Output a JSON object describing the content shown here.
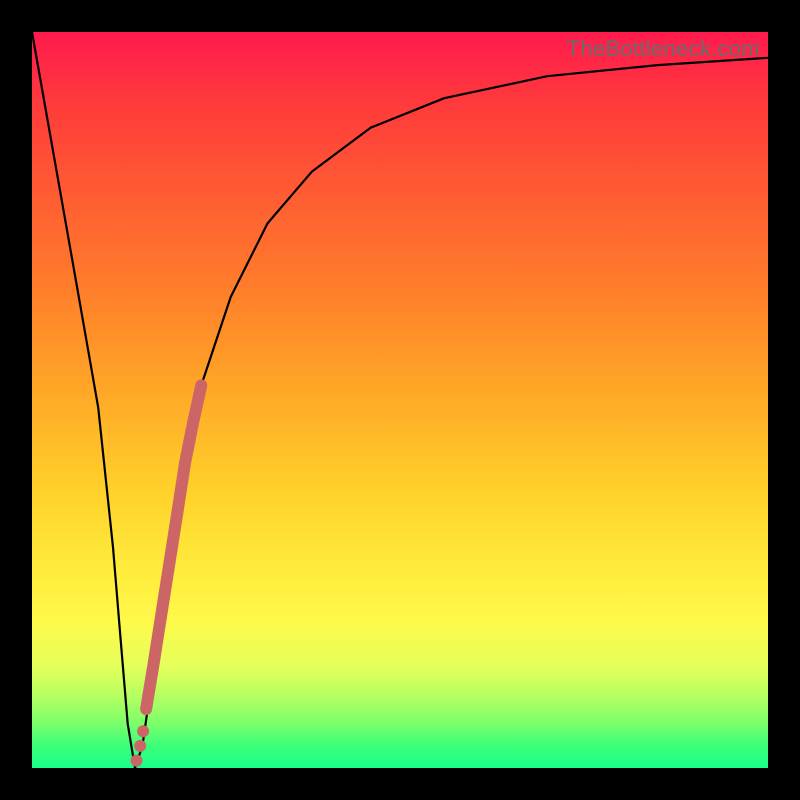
{
  "watermark": "TheBottleneck.com",
  "chart_data": {
    "type": "line",
    "title": "",
    "xlabel": "",
    "ylabel": "",
    "xlim": [
      0,
      100
    ],
    "ylim": [
      0,
      100
    ],
    "series": [
      {
        "name": "bottleneck-curve",
        "x": [
          0,
          3,
          6,
          9,
          11,
          12,
          13,
          14,
          15,
          16,
          18,
          20,
          23,
          27,
          32,
          38,
          46,
          56,
          70,
          85,
          100
        ],
        "y": [
          100,
          83,
          66,
          49,
          30,
          18,
          6,
          0,
          3,
          10,
          25,
          38,
          52,
          64,
          74,
          81,
          87,
          91,
          94,
          95.5,
          96.5
        ]
      },
      {
        "name": "highlight-segment",
        "x": [
          15.5,
          16.5,
          17.6,
          18.7,
          19.8,
          20.8,
          21.9,
          23.0
        ],
        "y": [
          8.0,
          14.0,
          21.0,
          28.0,
          35.0,
          41.5,
          47.0,
          52.0
        ]
      },
      {
        "name": "highlight-dots",
        "x": [
          14.2,
          14.7,
          15.1
        ],
        "y": [
          1.0,
          3.0,
          5.0
        ]
      }
    ],
    "colors": {
      "curve": "#000000",
      "highlight": "#cc6666"
    }
  }
}
